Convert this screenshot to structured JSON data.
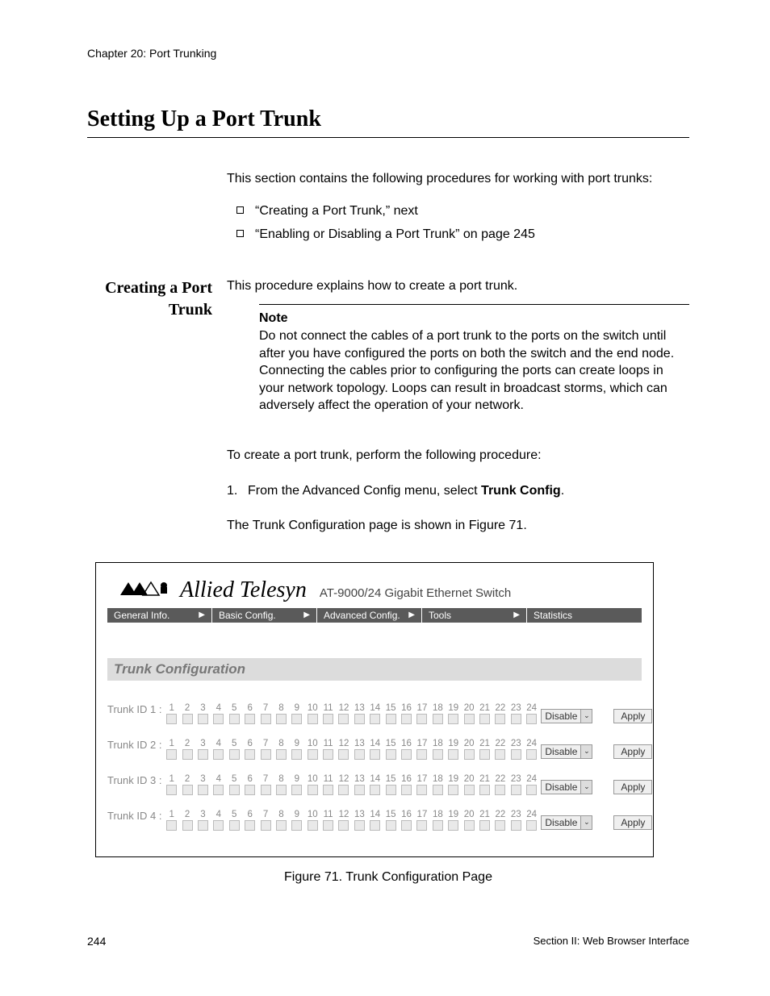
{
  "header": {
    "chapter": "Chapter 20: Port Trunking"
  },
  "title": "Setting Up a Port Trunk",
  "intro": "This section contains the following procedures for working with port trunks:",
  "bullets": [
    "“Creating a Port Trunk,”  next",
    "“Enabling or Disabling a Port Trunk” on page 245"
  ],
  "subheading": {
    "l1": "Creating a Port",
    "l2": "Trunk"
  },
  "proc_intro": "This procedure explains how to create a port trunk.",
  "note": {
    "label": "Note",
    "text": "Do not connect the cables of a port trunk to the ports on the switch until after you have configured the ports on both the switch and the end node. Connecting the cables prior to configuring the ports can create loops in your network topology. Loops can result in broadcast storms, which can adversely affect the operation of your network."
  },
  "body1": "To create a port trunk, perform the following procedure:",
  "step1": {
    "num": "1.",
    "pre": "From the Advanced Config menu, select ",
    "strong": "Trunk Config",
    "post": "."
  },
  "body2": "The Trunk Configuration page is shown in Figure 71.",
  "figure": {
    "brand": "Allied Telesyn",
    "brand_sub": "AT-9000/24 Gigabit Ethernet Switch",
    "nav": [
      "General Info.",
      "Basic Config.",
      "Advanced Config.",
      "Tools",
      "Statistics"
    ],
    "section_title": "Trunk Configuration",
    "port_numbers": [
      "1",
      "2",
      "3",
      "4",
      "5",
      "6",
      "7",
      "8",
      "9",
      "10",
      "11",
      "12",
      "13",
      "14",
      "15",
      "16",
      "17",
      "18",
      "19",
      "20",
      "21",
      "22",
      "23",
      "24"
    ],
    "rows": [
      {
        "label": "Trunk ID 1 :",
        "select": "Disable",
        "btn": "Apply"
      },
      {
        "label": "Trunk ID 2 :",
        "select": "Disable",
        "btn": "Apply"
      },
      {
        "label": "Trunk ID 3 :",
        "select": "Disable",
        "btn": "Apply"
      },
      {
        "label": "Trunk ID 4 :",
        "select": "Disable",
        "btn": "Apply"
      }
    ],
    "caption": "Figure 71. Trunk Configuration Page"
  },
  "footer": {
    "page_num": "244",
    "section": "Section II: Web Browser Interface"
  }
}
